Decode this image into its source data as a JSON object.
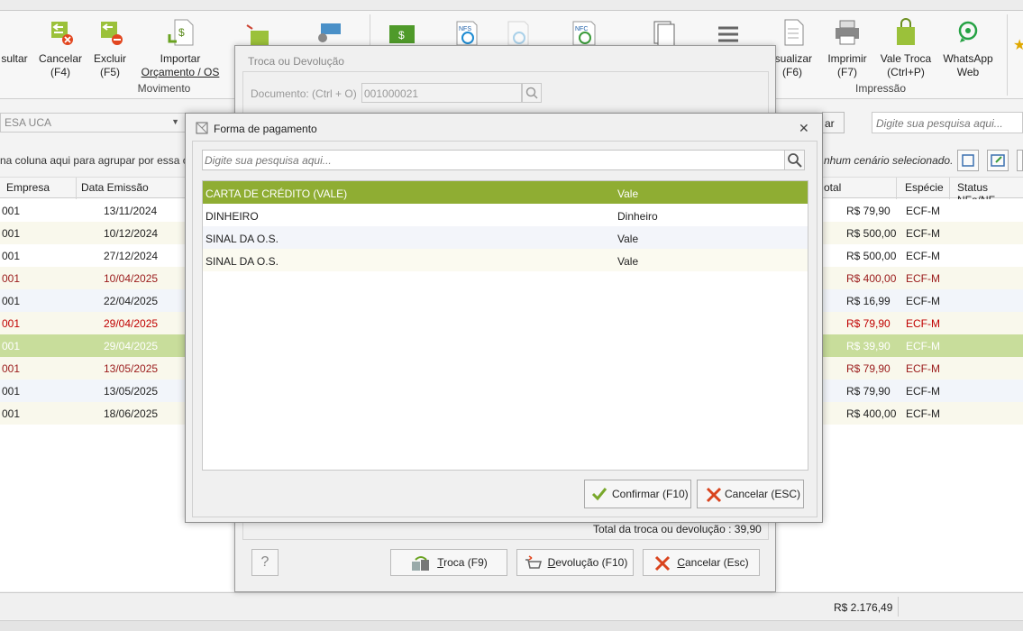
{
  "ribbon": {
    "buttons": [
      {
        "label1": "sultar",
        "label2": ""
      },
      {
        "label1": "Cancelar",
        "label2": "(F4)"
      },
      {
        "label1": "Excluir",
        "label2": "(F5)"
      },
      {
        "label1": "Importar",
        "label2": "Orçamento / OS"
      },
      {
        "label1": "isualizar",
        "label2": "(F6)"
      },
      {
        "label1": "Imprimir",
        "label2": "(F7)"
      },
      {
        "label1": "Vale Troca",
        "label2": "(Ctrl+P)"
      },
      {
        "label1": "WhatsApp",
        "label2": "Web"
      }
    ],
    "groups": {
      "movimento": "Movimento",
      "impressao": "Impressão"
    }
  },
  "toolbar": {
    "combo_value": "ESA UCA",
    "search_placeholder": "Digite sua pesquisa aqui...",
    "partial_btn": "ar",
    "group_hint": "na coluna aqui para agrupar por essa co",
    "scenario": "nhum cenário selecionado."
  },
  "grid": {
    "headers": {
      "empresa": "Empresa",
      "data": "Data Emissão",
      "total": "otal",
      "especie": "Espécie",
      "status": "Status NFe/NF"
    },
    "rows": [
      {
        "empresa": "001",
        "data": "13/11/2024",
        "total": "R$ 79,90",
        "especie": "ECF-M",
        "style": "norm",
        "tone": ""
      },
      {
        "empresa": "001",
        "data": "10/12/2024",
        "total": "R$ 500,00",
        "especie": "ECF-M",
        "style": "alt",
        "tone": ""
      },
      {
        "empresa": "001",
        "data": "27/12/2024",
        "total": "R$ 500,00",
        "especie": "ECF-M",
        "style": "norm",
        "tone": ""
      },
      {
        "empresa": "001",
        "data": "10/04/2025",
        "total": "R$ 400,00",
        "especie": "ECF-M",
        "style": "alt",
        "tone": "dred"
      },
      {
        "empresa": "001",
        "data": "22/04/2025",
        "total": "R$ 16,99",
        "especie": "ECF-M",
        "style": "blue",
        "tone": ""
      },
      {
        "empresa": "001",
        "data": "29/04/2025",
        "total": "R$ 79,90",
        "especie": "ECF-M",
        "style": "alt",
        "tone": "red"
      },
      {
        "empresa": "001",
        "data": "29/04/2025",
        "total": "R$ 39,90",
        "especie": "ECF-M",
        "style": "sel",
        "tone": ""
      },
      {
        "empresa": "001",
        "data": "13/05/2025",
        "total": "R$ 79,90",
        "especie": "ECF-M",
        "style": "alt",
        "tone": "dred"
      },
      {
        "empresa": "001",
        "data": "13/05/2025",
        "total": "R$ 79,90",
        "especie": "ECF-M",
        "style": "blue",
        "tone": ""
      },
      {
        "empresa": "001",
        "data": "18/06/2025",
        "total": "R$ 400,00",
        "especie": "ECF-M",
        "style": "alt",
        "tone": ""
      }
    ],
    "footer_total": "R$ 2.176,49"
  },
  "troca_dialog": {
    "title": "Troca ou Devolução",
    "doc_label": "Documento: (Ctrl + O)",
    "doc_value": "001000021",
    "total_line": "Total da troca ou devolução : 39,90",
    "help": "?",
    "btn_troca": {
      "u": "T",
      "rest": "roca (F9)"
    },
    "btn_devolucao": {
      "u": "D",
      "rest": "evolução (F10)"
    },
    "btn_cancelar": {
      "u": "C",
      "rest": "ancelar (Esc)"
    }
  },
  "pay_dialog": {
    "title": "Forma de pagamento",
    "search_placeholder": "Digite sua pesquisa aqui...",
    "rows": [
      {
        "name": "CARTA DE CRÉDITO (VALE)",
        "type": "Vale"
      },
      {
        "name": "DINHEIRO",
        "type": "Dinheiro"
      },
      {
        "name": "SINAL DA O.S.",
        "type": "Vale"
      },
      {
        "name": "SINAL DA O.S.",
        "type": "Vale"
      }
    ],
    "confirm": "Confirmar (F10)",
    "cancel": "Cancelar (ESC)"
  },
  "colors": {
    "accent_green": "#8fad33",
    "selected_row": "#c8dd9b",
    "red": "#c00000"
  }
}
